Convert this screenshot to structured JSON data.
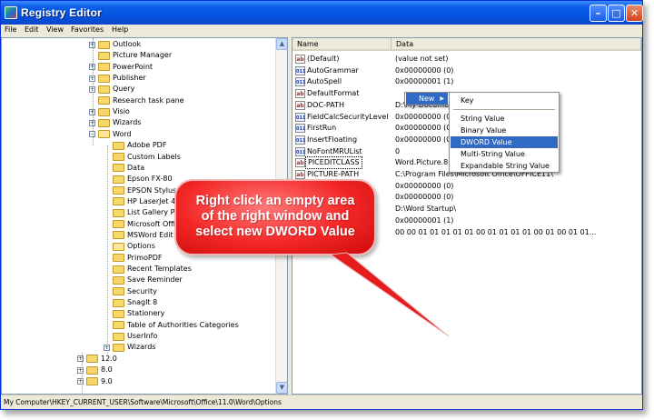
{
  "window": {
    "title": "Registry Editor",
    "controls": {
      "minimize": "–",
      "maximize": "□",
      "close": "✕"
    }
  },
  "menubar": [
    "File",
    "Edit",
    "View",
    "Favorites",
    "Help"
  ],
  "tree": {
    "items": [
      {
        "label": "Outlook",
        "expander": "+",
        "open": false
      },
      {
        "label": "Picture Manager",
        "expander": "",
        "open": false
      },
      {
        "label": "PowerPoint",
        "expander": "+",
        "open": false
      },
      {
        "label": "Publisher",
        "expander": "+",
        "open": false
      },
      {
        "label": "Query",
        "expander": "+",
        "open": false
      },
      {
        "label": "Research task pane",
        "expander": "",
        "open": false
      },
      {
        "label": "Visio",
        "expander": "+",
        "open": false
      },
      {
        "label": "Wizards",
        "expander": "+",
        "open": false
      },
      {
        "label": "Word",
        "expander": "−",
        "open": true
      },
      {
        "label": "Adobe PDF",
        "expander": "",
        "open": false
      },
      {
        "label": "Custom Labels",
        "expander": "",
        "open": false
      },
      {
        "label": "Data",
        "expander": "",
        "open": false
      },
      {
        "label": "Epson FX-80",
        "expander": "",
        "open": false
      },
      {
        "label": "EPSON Stylus P",
        "expander": "",
        "open": false
      },
      {
        "label": "HP LaserJet 4",
        "expander": "",
        "open": false
      },
      {
        "label": "List Gallery Pr",
        "expander": "",
        "open": false
      },
      {
        "label": "Microsoft Offi",
        "expander": "",
        "open": false
      },
      {
        "label": "MSWord Edit",
        "expander": "",
        "open": false
      },
      {
        "label": "Options",
        "expander": "",
        "open": true
      },
      {
        "label": "PrimoPDF",
        "expander": "",
        "open": false
      },
      {
        "label": "Recent Templates",
        "expander": "",
        "open": false
      },
      {
        "label": "Save Reminder",
        "expander": "",
        "open": false
      },
      {
        "label": "Security",
        "expander": "",
        "open": false
      },
      {
        "label": "SnagIt 8",
        "expander": "",
        "open": false
      },
      {
        "label": "Stationery",
        "expander": "",
        "open": false
      },
      {
        "label": "Table of Authorities Categories",
        "expander": "",
        "open": false
      },
      {
        "label": "UserInfo",
        "expander": "",
        "open": false
      },
      {
        "label": "Wizards",
        "expander": "+",
        "open": false
      },
      {
        "label": "12.0",
        "expander": "+",
        "open": false
      },
      {
        "label": "8.0",
        "expander": "+",
        "open": false
      },
      {
        "label": "9.0",
        "expander": "+",
        "open": false
      }
    ]
  },
  "list": {
    "columns": [
      "Name",
      "Data"
    ],
    "rows": [
      {
        "icon": "ab",
        "name": "(Default)",
        "data": "(value not set)"
      },
      {
        "icon": "bin",
        "name": "AutoGrammar",
        "data": "0x00000000 (0)"
      },
      {
        "icon": "bin",
        "name": "AutoSpell",
        "data": "0x00000001 (1)"
      },
      {
        "icon": "ab",
        "name": "DefaultFormat",
        "data": ""
      },
      {
        "icon": "ab",
        "name": "DOC-PATH",
        "data": "D:\\My Documents"
      },
      {
        "icon": "bin",
        "name": "FieldCalcSecurityLevel",
        "data": "0x00000000 (0)"
      },
      {
        "icon": "bin",
        "name": "FirstRun",
        "data": "0x00000000 (0)"
      },
      {
        "icon": "bin",
        "name": "InsertFloating",
        "data": "0x00000000 (0)"
      },
      {
        "icon": "bin",
        "name": "NoFontMRUList",
        "data": "0"
      },
      {
        "icon": "ab",
        "name": "PICEDITCLASS",
        "data": "Word.Picture.8"
      },
      {
        "icon": "ab",
        "name": "PICTURE-PATH",
        "data": "C:\\Program Files\\Microsoft Office\\OFFICE11\\"
      },
      {
        "icon": "bin",
        "name": "",
        "data": "0x00000000 (0)"
      },
      {
        "icon": "bin",
        "name": "",
        "data": "0x00000000 (0)"
      },
      {
        "icon": "ab",
        "name": "",
        "data": "D:\\Word Startup\\"
      },
      {
        "icon": "bin",
        "name": "",
        "data": "0x00000001 (1)"
      },
      {
        "icon": "bin",
        "name": "",
        "data": "00 00 01 01 01 01 01 00 01 01 01 01 00 01 00 01 01..."
      }
    ]
  },
  "context_menu": {
    "new_label": "New",
    "submenu": [
      "Key",
      "String Value",
      "Binary Value",
      "DWORD Value",
      "Multi-String Value",
      "Expandable String Value"
    ],
    "highlighted": "DWORD Value"
  },
  "callout": {
    "lines": [
      "Right click an empty area",
      "of the right window and",
      "select new DWORD Value"
    ]
  },
  "statusbar": {
    "path": "My Computer\\HKEY_CURRENT_USER\\Software\\Microsoft\\Office\\11.0\\Word\\Options"
  },
  "colors": {
    "titlebar": "#0a5ee8",
    "highlight": "#316ac5",
    "callout": "#f32626"
  }
}
